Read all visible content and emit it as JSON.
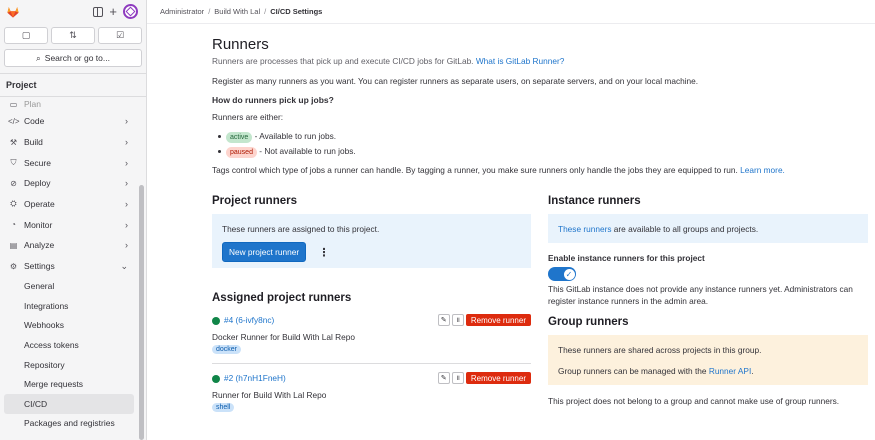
{
  "breadcrumb": {
    "items": [
      "Administrator",
      "Build With Lal",
      "CI/CD Settings"
    ]
  },
  "sidebar": {
    "search_label": "Search or go to...",
    "section": "Project",
    "items": [
      {
        "label": "Plan",
        "icon": "plan-icon"
      },
      {
        "label": "Code",
        "icon": "code-icon"
      },
      {
        "label": "Build",
        "icon": "build-icon"
      },
      {
        "label": "Secure",
        "icon": "shield-icon"
      },
      {
        "label": "Deploy",
        "icon": "deploy-icon"
      },
      {
        "label": "Operate",
        "icon": "operate-icon"
      },
      {
        "label": "Monitor",
        "icon": "monitor-icon"
      },
      {
        "label": "Analyze",
        "icon": "analyze-icon"
      },
      {
        "label": "Settings",
        "icon": "gear-icon"
      }
    ],
    "settings_sub": [
      "General",
      "Integrations",
      "Webhooks",
      "Access tokens",
      "Repository",
      "Merge requests",
      "CI/CD",
      "Packages and registries"
    ]
  },
  "runners": {
    "title": "Runners",
    "subtitle": "Runners are processes that pick up and execute CI/CD jobs for GitLab.",
    "subtitle_link": "What is GitLab Runner?",
    "register_text": "Register as many runners as you want. You can register runners as separate users, on separate servers, and on your local machine.",
    "how_heading": "How do runners pick up jobs?",
    "either": "Runners are either:",
    "active_badge": "active",
    "active_text": " - Available to run jobs.",
    "paused_badge": "paused",
    "paused_text": " - Not available to run jobs.",
    "tags_text": "Tags control which type of jobs a runner can handle. By tagging a runner, you make sure runners only handle the jobs they are equipped to run.",
    "learn_more": "Learn more."
  },
  "project_runners": {
    "title": "Project runners",
    "assigned_text": "These runners are assigned to this project.",
    "new_button": "New project runner",
    "assigned_title": "Assigned project runners",
    "list": [
      {
        "id": "#4 (6-ivfy8nc)",
        "description": "Docker Runner for Build With Lal Repo",
        "tag": "docker",
        "remove": "Remove runner"
      },
      {
        "id": "#2 (h7nH1FneH)",
        "description": "Runner for Build With Lal Repo",
        "tag": "shell",
        "remove": "Remove runner"
      }
    ]
  },
  "instance_runners": {
    "title": "Instance runners",
    "panel_link": "These runners",
    "panel_text": " are available to all groups and projects.",
    "toggle_label": "Enable instance runners for this project",
    "note": "This GitLab instance does not provide any instance runners yet. Administrators can register instance runners in the admin area."
  },
  "group_runners": {
    "title": "Group runners",
    "shared_text": "These runners are shared across projects in this group.",
    "managed_text": "Group runners can be managed with the",
    "api_link": "Runner API",
    "managed_end": ".",
    "note": "This project does not belong to a group and cannot make use of group runners."
  }
}
